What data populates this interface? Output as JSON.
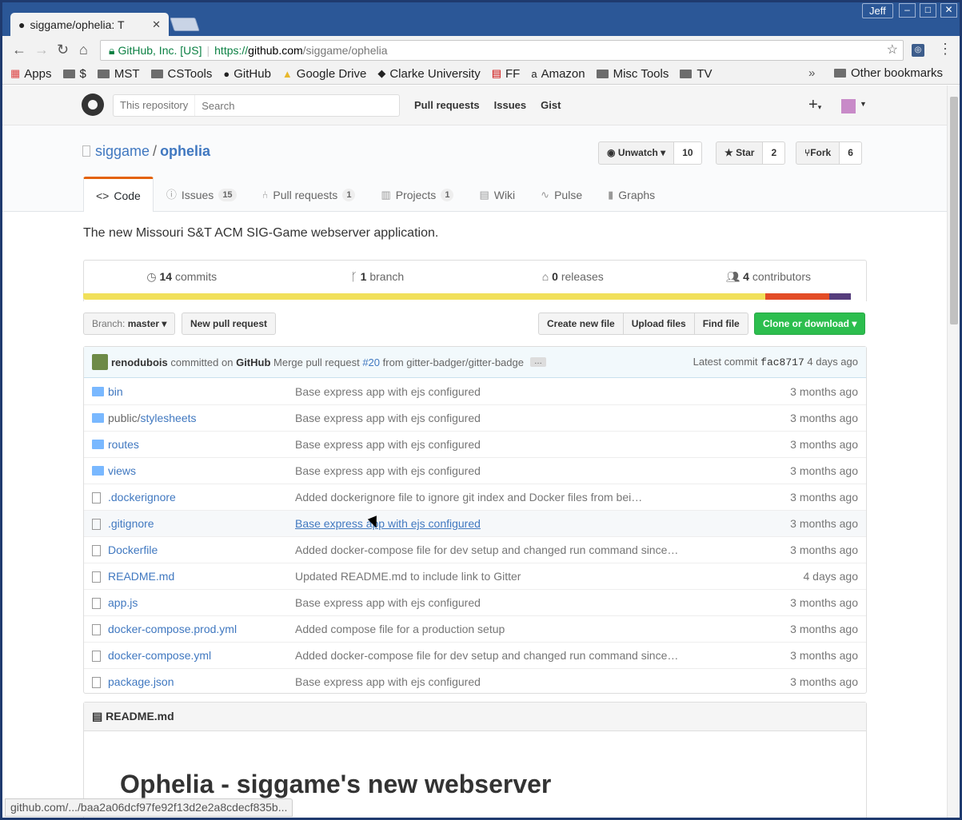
{
  "browser": {
    "tab_title": "siggame/ophelia: T",
    "user": "Jeff",
    "url_security": "GitHub, Inc. [US]",
    "url_scheme": "https://",
    "url_host": "github.com",
    "url_path": "/siggame/ophelia",
    "bookmarks": [
      "Apps",
      "$",
      "MST",
      "CSTools",
      "GitHub",
      "Google Drive",
      "Clarke University",
      "FF",
      "Amazon",
      "Misc Tools",
      "TV"
    ],
    "bookmarks_more": "»",
    "other_bookmarks": "Other bookmarks",
    "status_url": "github.com/.../baa2a06dcf97fe92f13d2e2a8cdecf835b..."
  },
  "gh_header": {
    "search_scope": "This repository",
    "search_placeholder": "Search",
    "nav": [
      "Pull requests",
      "Issues",
      "Gist"
    ]
  },
  "repo": {
    "owner": "siggame",
    "name": "ophelia",
    "watch_label": "Unwatch",
    "watch_count": "10",
    "star_label": "Star",
    "star_count": "2",
    "fork_label": "Fork",
    "fork_count": "6",
    "tabs": [
      {
        "label": "Code",
        "count": ""
      },
      {
        "label": "Issues",
        "count": "15"
      },
      {
        "label": "Pull requests",
        "count": "1"
      },
      {
        "label": "Projects",
        "count": "1"
      },
      {
        "label": "Wiki",
        "count": ""
      },
      {
        "label": "Pulse",
        "count": ""
      },
      {
        "label": "Graphs",
        "count": ""
      }
    ],
    "description": "The new Missouri S&T ACM SIG-Game webserver application.",
    "summary": {
      "commits_n": "14",
      "commits": "commits",
      "branch_n": "1",
      "branch": "branch",
      "releases_n": "0",
      "releases": "releases",
      "contributors_n": "4",
      "contributors": "contributors"
    },
    "lang_colors": [
      "#f1e05a",
      "#e34c26",
      "#563d7c"
    ],
    "lang_share": [
      0.87,
      0.082,
      0.028
    ],
    "branch_prefix": "Branch:",
    "branch_name": "master",
    "new_pr": "New pull request",
    "create_file": "Create new file",
    "upload_files": "Upload files",
    "find_file": "Find file",
    "clone": "Clone or download"
  },
  "commit": {
    "author": "renodubois",
    "via": "committed on",
    "via_target": "GitHub",
    "message_pre": "Merge pull request",
    "pr": "#20",
    "message_post": "from gitter-badger/gitter-badge",
    "ellipsis": "…",
    "latest_label": "Latest commit",
    "sha": "fac8717",
    "age": "4 days ago"
  },
  "files": [
    {
      "type": "dir",
      "prefix": "",
      "name": "bin",
      "msg": "Base express app with ejs configured",
      "age": "3 months ago"
    },
    {
      "type": "dir",
      "prefix": "public/",
      "name": "stylesheets",
      "msg": "Base express app with ejs configured",
      "age": "3 months ago"
    },
    {
      "type": "dir",
      "prefix": "",
      "name": "routes",
      "msg": "Base express app with ejs configured",
      "age": "3 months ago"
    },
    {
      "type": "dir",
      "prefix": "",
      "name": "views",
      "msg": "Base express app with ejs configured",
      "age": "3 months ago"
    },
    {
      "type": "file",
      "prefix": "",
      "name": ".dockerignore",
      "msg": "Added dockerignore file to ignore git index and Docker files from bei…",
      "age": "3 months ago"
    },
    {
      "type": "file",
      "prefix": "",
      "name": ".gitignore",
      "msg": "Base express app with ejs configured",
      "age": "3 months ago"
    },
    {
      "type": "file",
      "prefix": "",
      "name": "Dockerfile",
      "msg": "Added docker-compose file for dev setup and changed run command since…",
      "age": "3 months ago"
    },
    {
      "type": "file",
      "prefix": "",
      "name": "README.md",
      "msg": "Updated README.md to include link to Gitter",
      "age": "4 days ago"
    },
    {
      "type": "file",
      "prefix": "",
      "name": "app.js",
      "msg": "Base express app with ejs configured",
      "age": "3 months ago"
    },
    {
      "type": "file",
      "prefix": "",
      "name": "docker-compose.prod.yml",
      "msg": "Added compose file for a production setup",
      "age": "3 months ago"
    },
    {
      "type": "file",
      "prefix": "",
      "name": "docker-compose.yml",
      "msg": "Added docker-compose file for dev setup and changed run command since…",
      "age": "3 months ago"
    },
    {
      "type": "file",
      "prefix": "",
      "name": "package.json",
      "msg": "Base express app with ejs configured",
      "age": "3 months ago"
    }
  ],
  "readme": {
    "header": "README.md",
    "title": "Ophelia - siggame's new webserver"
  }
}
